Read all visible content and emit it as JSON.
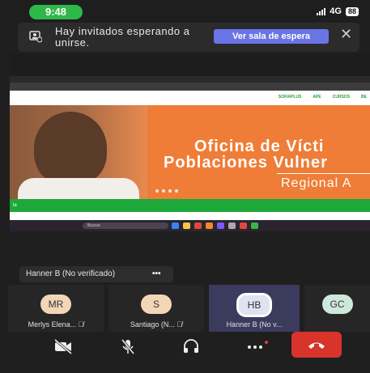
{
  "status_bar": {
    "time": "9:48",
    "network": "4G",
    "battery": "88"
  },
  "banner": {
    "icon": "waiting-room-icon",
    "text": "Hay invitados esperando a unirse.",
    "button_label": "Ver sala de espera",
    "close_icon": "close-icon"
  },
  "shared_screen": {
    "nav_links": [
      "SOFIAPLUS",
      "APE",
      "CURSOS",
      "BE"
    ],
    "hero_line1": "Oficina de Vícti",
    "hero_line2": "Poblaciones Vulner",
    "hero_line3": "Regional A",
    "green_bar_text": "la",
    "taskbar_search": "Buscar"
  },
  "speaker": {
    "name": "Hanner B (No verificado)",
    "more": "•••"
  },
  "participants": [
    {
      "initials": "MR",
      "name": "Merlys Elena...",
      "color": "#f3d6b8"
    },
    {
      "initials": "S",
      "name": "Santiago (N...",
      "color": "#f3d6b8"
    },
    {
      "initials": "HB",
      "name": "Hanner B (No v...",
      "color": "#dfe3f0",
      "active": true
    },
    {
      "initials": "GC",
      "name": "",
      "color": "#cfe8dc"
    }
  ],
  "controls": {
    "video": "video-off-icon",
    "mic": "mic-off-icon",
    "audio": "headphones-icon",
    "more": "more-icon",
    "hangup": "hang-up-icon"
  },
  "colors": {
    "accent": "#6b74e6",
    "hangup": "#d9342b",
    "time_pill": "#2fb84a",
    "hero": "#ef7d37",
    "green_bar": "#1ea83a"
  }
}
